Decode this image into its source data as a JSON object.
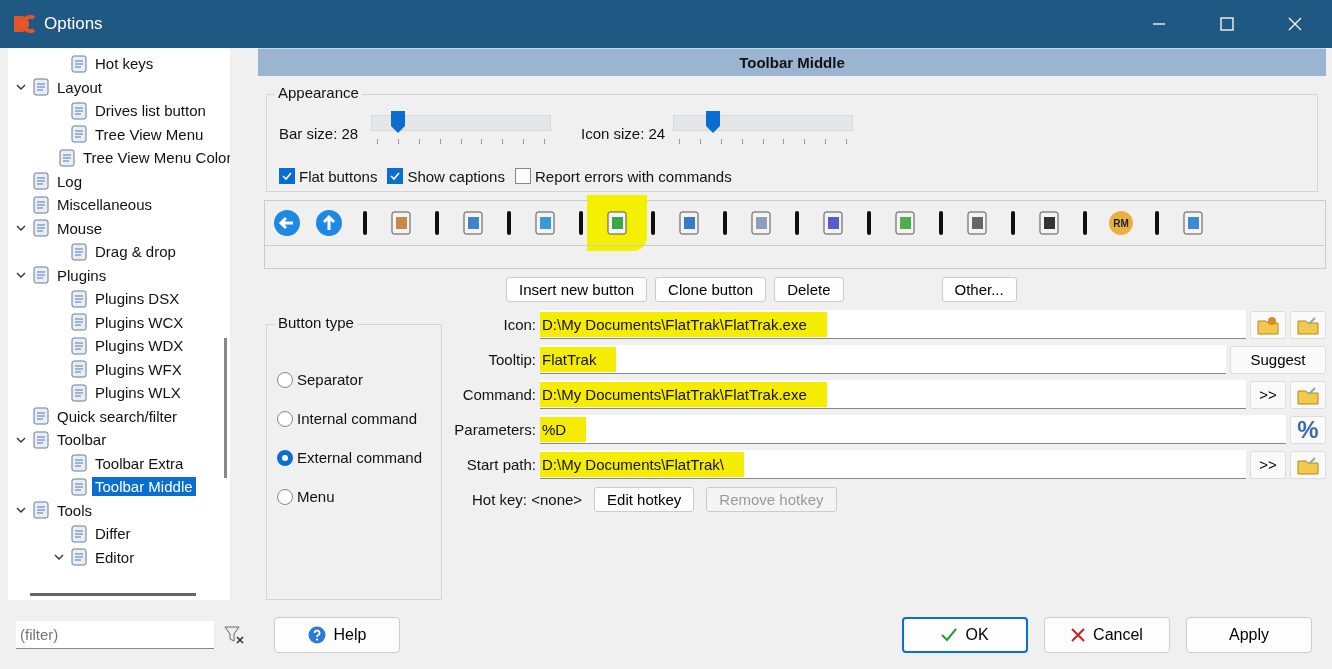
{
  "window": {
    "title": "Options"
  },
  "tree": [
    {
      "children": [
        {
          "label": "Hot keys",
          "selected": false
        }
      ]
    },
    {
      "label": "Layout",
      "expanded": true,
      "selected": false,
      "children": [
        {
          "label": "Drives list button",
          "selected": false
        },
        {
          "label": "Tree View Menu",
          "selected": false
        },
        {
          "label": "Tree View Menu Color",
          "selected": false
        }
      ]
    },
    {
      "label": "Log",
      "selected": false
    },
    {
      "label": "Miscellaneous",
      "selected": false
    },
    {
      "label": "Mouse",
      "expanded": true,
      "selected": false,
      "children": [
        {
          "label": "Drag & drop",
          "selected": false
        }
      ]
    },
    {
      "label": "Plugins",
      "expanded": true,
      "selected": false,
      "children": [
        {
          "label": "Plugins DSX",
          "selected": false
        },
        {
          "label": "Plugins WCX",
          "selected": false
        },
        {
          "label": "Plugins WDX",
          "selected": false
        },
        {
          "label": "Plugins WFX",
          "selected": false
        },
        {
          "label": "Plugins WLX",
          "selected": false
        }
      ]
    },
    {
      "label": "Quick search/filter",
      "selected": false
    },
    {
      "label": "Toolbar",
      "expanded": true,
      "selected": false,
      "children": [
        {
          "label": "Toolbar Extra",
          "selected": false
        },
        {
          "label": "Toolbar Middle",
          "selected": true
        }
      ]
    },
    {
      "label": "Tools",
      "expanded": true,
      "selected": false,
      "children": [
        {
          "label": "Differ",
          "selected": false
        },
        {
          "label": "Editor",
          "expanded": true,
          "selected": false
        }
      ]
    }
  ],
  "filter": {
    "placeholder": "(filter)"
  },
  "page_title": "Toolbar Middle",
  "appearance": {
    "title": "Appearance",
    "sliders": [
      {
        "label": "Bar size: 28",
        "level": 0.12
      },
      {
        "label": "Icon size: 24",
        "level": 0.2
      }
    ],
    "checkboxes": [
      {
        "label": "Flat buttons",
        "checked": true
      },
      {
        "label": "Show captions",
        "checked": true
      },
      {
        "label": "Report errors with commands",
        "checked": false
      }
    ]
  },
  "toolbar": [
    {
      "kind": "button",
      "selected": false
    },
    {
      "kind": "button",
      "selected": false
    },
    {
      "kind": "separator"
    },
    {
      "kind": "button",
      "selected": false
    },
    {
      "kind": "separator"
    },
    {
      "kind": "button",
      "selected": false
    },
    {
      "kind": "separator"
    },
    {
      "kind": "button",
      "selected": false
    },
    {
      "kind": "separator"
    },
    {
      "kind": "button",
      "selected": true
    },
    {
      "kind": "separator"
    },
    {
      "kind": "button",
      "selected": false
    },
    {
      "kind": "separator"
    },
    {
      "kind": "button",
      "selected": false
    },
    {
      "kind": "separator"
    },
    {
      "kind": "button",
      "selected": false
    },
    {
      "kind": "separator"
    },
    {
      "kind": "button",
      "selected": false
    },
    {
      "kind": "separator"
    },
    {
      "kind": "button",
      "selected": false
    },
    {
      "kind": "separator"
    },
    {
      "kind": "button",
      "selected": false
    },
    {
      "kind": "separator"
    },
    {
      "kind": "button",
      "selected": false,
      "label": "RM"
    },
    {
      "kind": "separator"
    },
    {
      "kind": "button",
      "selected": false
    }
  ],
  "actions": [
    "Insert new button",
    "Clone button",
    "Delete",
    "Other..."
  ],
  "button_type": {
    "title": "Button type",
    "options": [
      {
        "label": "Separator",
        "selected": false
      },
      {
        "label": "Internal command",
        "selected": false
      },
      {
        "label": "External command",
        "selected": true
      },
      {
        "label": "Menu",
        "selected": false
      }
    ]
  },
  "fields": [
    {
      "label": "Icon:",
      "value": "D:\\My Documents\\FlatTrak\\FlatTrak.exe",
      "highlighted": true,
      "buttons": [
        {
          "kind": "open"
        },
        {
          "kind": "browse"
        }
      ]
    },
    {
      "label": "Tooltip:",
      "value": "FlatTrak",
      "highlighted": true,
      "buttons": [
        {
          "kind": "text",
          "label": "Suggest"
        }
      ]
    },
    {
      "label": "Command:",
      "value": "D:\\My Documents\\FlatTrak\\FlatTrak.exe",
      "highlighted": true,
      "buttons": [
        {
          "kind": "text",
          "label": ">>"
        },
        {
          "kind": "browse"
        }
      ]
    },
    {
      "label": "Parameters:",
      "value": "%D",
      "highlighted": true,
      "buttons": [
        {
          "kind": "text",
          "label": "%"
        }
      ]
    },
    {
      "label": "Start path:",
      "value": "D:\\My Documents\\FlatTrak\\",
      "highlighted": true,
      "buttons": [
        {
          "kind": "text",
          "label": ">>"
        },
        {
          "kind": "browse"
        }
      ]
    }
  ],
  "hotkey": {
    "label": "Hot key: <none>",
    "buttons": [
      {
        "label": "Edit hotkey",
        "disabled": false
      },
      {
        "label": "Remove hotkey",
        "disabled": true
      }
    ]
  },
  "footer": {
    "help": "Help",
    "ok": "OK",
    "cancel": "Cancel",
    "apply": "Apply"
  }
}
